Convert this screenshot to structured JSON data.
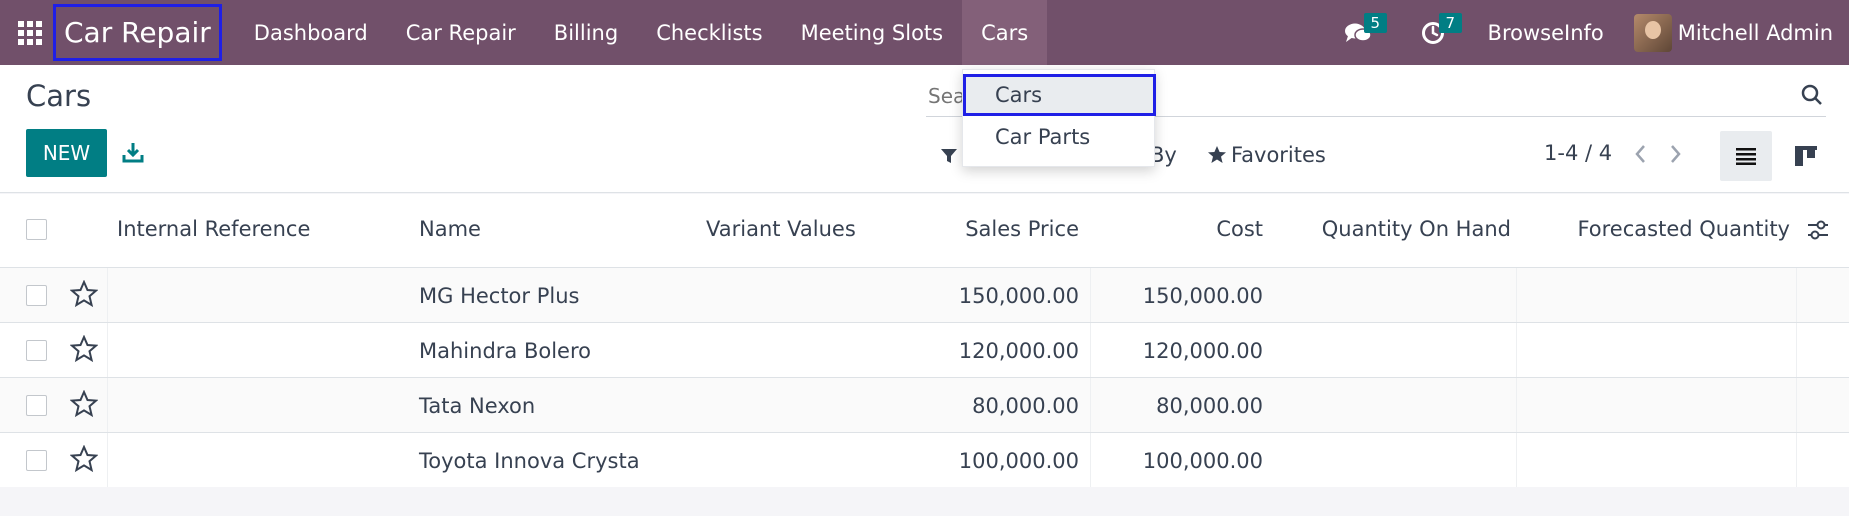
{
  "navbar": {
    "apps_icon": "grid-icon",
    "brand": "Car Repair",
    "menu": [
      {
        "label": "Dashboard"
      },
      {
        "label": "Car Repair"
      },
      {
        "label": "Billing"
      },
      {
        "label": "Checklists"
      },
      {
        "label": "Meeting Slots"
      },
      {
        "label": "Cars",
        "active": true
      }
    ],
    "messages_count": "5",
    "activities_count": "7",
    "company": "BrowseInfo",
    "user": "Mitchell Admin",
    "accent_color": "#71506a"
  },
  "control": {
    "title": "Cars",
    "new_label": "NEW",
    "search_placeholder": "Search...",
    "groupby_tail": "By",
    "favorites": "Favorites",
    "pager": "1-4 / 4"
  },
  "dropdown": {
    "items": [
      {
        "label": "Cars",
        "selected": true
      },
      {
        "label": "Car Parts"
      }
    ]
  },
  "table": {
    "headers": {
      "internal_reference": "Internal Reference",
      "name": "Name",
      "variant_values": "Variant Values",
      "sales_price": "Sales Price",
      "cost": "Cost",
      "quantity_on_hand": "Quantity On Hand",
      "forecasted_quantity": "Forecasted Quantity"
    },
    "rows": [
      {
        "internal_reference": "",
        "name": "MG Hector Plus",
        "variant_values": "",
        "sales_price": "150,000.00",
        "cost": "150,000.00",
        "quantity_on_hand": "",
        "forecasted_quantity": ""
      },
      {
        "internal_reference": "",
        "name": "Mahindra Bolero",
        "variant_values": "",
        "sales_price": "120,000.00",
        "cost": "120,000.00",
        "quantity_on_hand": "",
        "forecasted_quantity": ""
      },
      {
        "internal_reference": "",
        "name": "Tata Nexon",
        "variant_values": "",
        "sales_price": "80,000.00",
        "cost": "80,000.00",
        "quantity_on_hand": "",
        "forecasted_quantity": ""
      },
      {
        "internal_reference": "",
        "name": "Toyota Innova Crysta",
        "variant_values": "",
        "sales_price": "100,000.00",
        "cost": "100,000.00",
        "quantity_on_hand": "",
        "forecasted_quantity": ""
      }
    ]
  }
}
